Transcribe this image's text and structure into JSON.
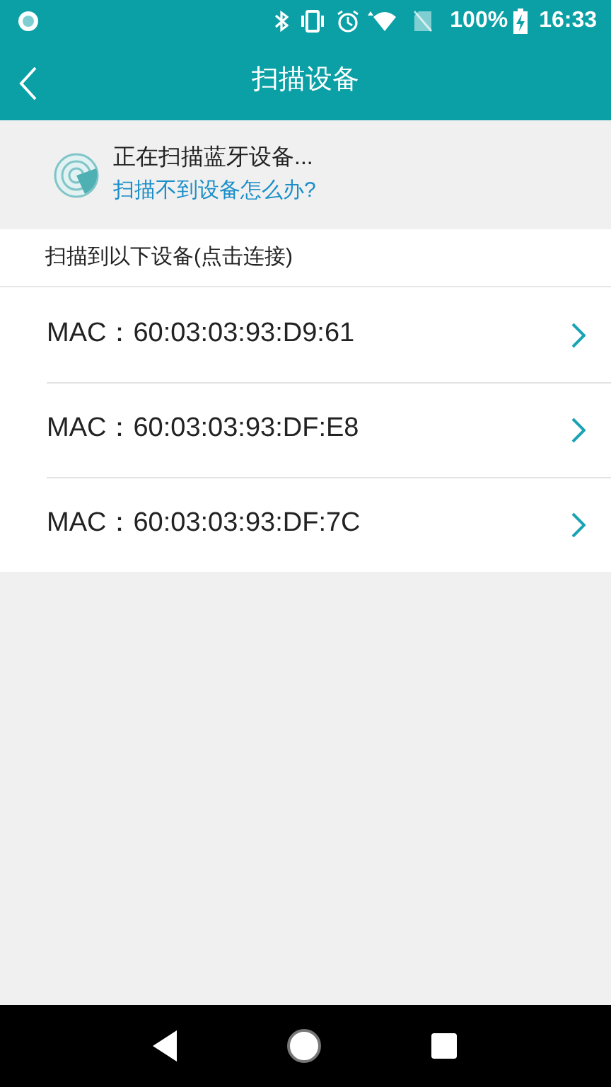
{
  "status_bar": {
    "battery": "100%",
    "time": "16:33"
  },
  "header": {
    "title": "扫描设备"
  },
  "scan": {
    "status": "正在扫描蓝牙设备...",
    "help_link": "扫描不到设备怎么办?"
  },
  "section_label": "扫描到以下设备(点击连接)",
  "devices": [
    {
      "label": "MAC：60:03:03:93:D9:61"
    },
    {
      "label": "MAC：60:03:03:93:DF:E8"
    },
    {
      "label": "MAC：60:03:03:93:DF:7C"
    }
  ]
}
